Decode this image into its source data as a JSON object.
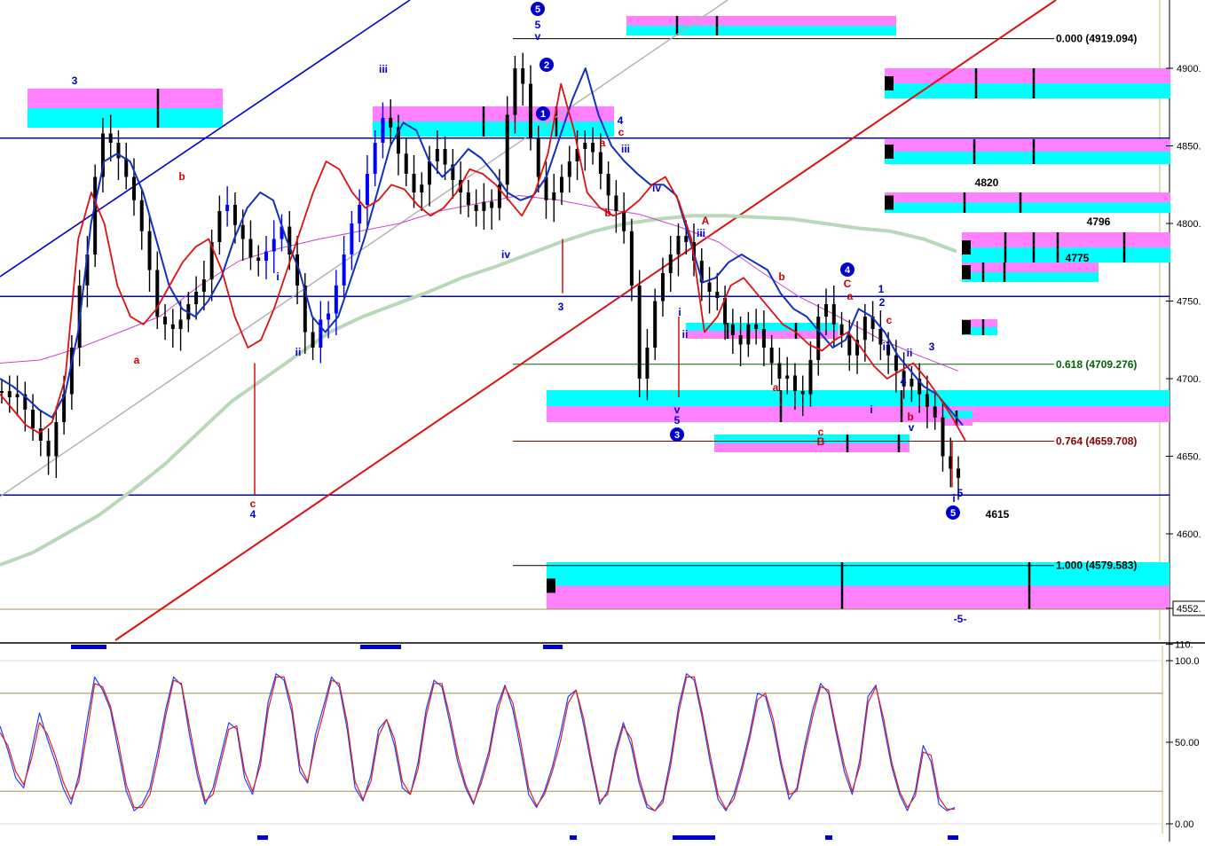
{
  "colors": {
    "background": "#ffffff",
    "hline": "#0000cc",
    "trend_blue": "#0000cc",
    "trend_red": "#dd1111",
    "trend_gray": "#b0b0b0",
    "ma_green": "#b8d8b8",
    "ma_pink": "#cc44cc",
    "env_blue": "#1030c0",
    "env_red": "#dd1111",
    "cyan": "#00ffff",
    "magenta": "#ff80ff",
    "stoch_blue": "#2040ff",
    "stoch_red": "#e02020",
    "grid_olive": "#a09050",
    "price_bars": "#000000",
    "up_bars": "#0000ff"
  },
  "chart_data": [
    {
      "type": "line",
      "panel": "price",
      "title": "",
      "ylim": [
        4552,
        4935
      ],
      "y_ticks": [
        "4900.",
        "4850.",
        "4800.",
        "4750.",
        "4700.",
        "4650.",
        "4600.",
        "4552."
      ],
      "y_tick_values": [
        4900,
        4850,
        4800,
        4750,
        4700,
        4650,
        4600,
        4552
      ],
      "horizontal_levels": [
        4855,
        4753,
        4625
      ],
      "fib_levels": [
        {
          "label": "0.000 (4919.094)",
          "value": 4919.094,
          "color": "#000000"
        },
        {
          "label": "0.618 (4709.276)",
          "value": 4709.276,
          "color": "#006600"
        },
        {
          "label": "0.764 (4659.708)",
          "value": 4659.708,
          "color": "#880000"
        },
        {
          "label": "1.000 (4579.583)",
          "value": 4579.583,
          "color": "#000000"
        }
      ],
      "level_labels": [
        "4820",
        "4796",
        "4775",
        "4615"
      ],
      "series": [
        {
          "role": "price_hl",
          "values": [
            4692,
            4688,
            4690,
            4680,
            4668,
            4660,
            4650,
            4672,
            4690,
            4720,
            4760,
            4780,
            4830,
            4858,
            4852,
            4842,
            4830,
            4815,
            4795,
            4770,
            4740,
            4735,
            4732,
            4738,
            4748,
            4756,
            4764,
            4788,
            4808,
            4812,
            4799,
            4790,
            4778,
            4776,
            4782,
            4790,
            4798,
            4780,
            4760,
            4730,
            4720,
            4738,
            4742,
            4760,
            4780,
            4800,
            4812,
            4832,
            4852,
            4868,
            4862,
            4845,
            4832,
            4820,
            4825,
            4840,
            4848,
            4838,
            4828,
            4820,
            4812,
            4808,
            4814,
            4810,
            4825,
            4870,
            4900,
            4890,
            4855,
            4830,
            4815,
            4820,
            4830,
            4840,
            4848,
            4852,
            4846,
            4832,
            4818,
            4808,
            4795,
            4760,
            4700,
            4720,
            4750,
            4768,
            4780,
            4792,
            4788,
            4776,
            4762,
            4756,
            4752,
            4735,
            4728,
            4722,
            4735,
            4732,
            4720,
            4710,
            4700,
            4702,
            4692,
            4690,
            4712,
            4740,
            4748,
            4735,
            4728,
            4715,
            4725,
            4740,
            4732,
            4722,
            4715,
            4705,
            4695,
            4700,
            4690,
            4682,
            4675,
            4650,
            4642,
            4636
          ]
        },
        {
          "role": "blue_band",
          "values": [
            4700,
            4695,
            4688,
            4680,
            4675,
            4690,
            4730,
            4800,
            4840,
            4845,
            4840,
            4820,
            4790,
            4760,
            4745,
            4740,
            4750,
            4765,
            4790,
            4810,
            4820,
            4815,
            4790,
            4770,
            4740,
            4730,
            4740,
            4765,
            4790,
            4820,
            4850,
            4865,
            4860,
            4840,
            4830,
            4838,
            4848,
            4842,
            4832,
            4820,
            4815,
            4818,
            4830,
            4855,
            4880,
            4900,
            4870,
            4850,
            4840,
            4832,
            4825,
            4825,
            4818,
            4790,
            4762,
            4765,
            4775,
            4780,
            4775,
            4770,
            4755,
            4745,
            4740,
            4730,
            4720,
            4725,
            4745,
            4740,
            4730,
            4715,
            4705,
            4695,
            4690,
            4680,
            4670
          ]
        },
        {
          "role": "red_band",
          "values": [
            4690,
            4680,
            4670,
            4665,
            4672,
            4700,
            4790,
            4820,
            4800,
            4760,
            4740,
            4735,
            4745,
            4760,
            4775,
            4785,
            4790,
            4770,
            4740,
            4720,
            4725,
            4745,
            4770,
            4795,
            4820,
            4840,
            4835,
            4820,
            4810,
            4815,
            4825,
            4822,
            4812,
            4805,
            4810,
            4820,
            4835,
            4832,
            4825,
            4815,
            4805,
            4820,
            4845,
            4890,
            4860,
            4820,
            4810,
            4805,
            4808,
            4815,
            4825,
            4830,
            4815,
            4790,
            4730,
            4740,
            4760,
            4765,
            4755,
            4745,
            4735,
            4730,
            4722,
            4718,
            4725,
            4730,
            4720,
            4708,
            4700,
            4705,
            4710,
            4700,
            4688,
            4675,
            4660
          ]
        },
        {
          "role": "sma_green",
          "values": [
            4580,
            4588,
            4600,
            4612,
            4628,
            4645,
            4665,
            4685,
            4700,
            4715,
            4730,
            4740,
            4748,
            4756,
            4765,
            4772,
            4780,
            4788,
            4795,
            4800,
            4803,
            4805,
            4805,
            4804,
            4803,
            4800,
            4797,
            4795,
            4790,
            4782
          ]
        },
        {
          "role": "ma_pink",
          "values": [
            4710,
            4712,
            4720,
            4730,
            4740,
            4760,
            4776,
            4784,
            4790,
            4795,
            4800,
            4808,
            4813,
            4818,
            4815,
            4810,
            4806,
            4798,
            4788,
            4770,
            4753,
            4740,
            4726,
            4715,
            4705
          ]
        }
      ]
    },
    {
      "type": "line",
      "panel": "stochastic",
      "ylim": [
        -2,
        110
      ],
      "y_ticks": [
        "110.",
        "100.0",
        "50.00",
        "0.00"
      ],
      "y_tick_values": [
        110,
        100,
        50,
        0
      ],
      "levels": [
        80,
        20
      ],
      "series": [
        {
          "role": "%K",
          "values": [
            60,
            45,
            28,
            22,
            45,
            68,
            52,
            38,
            22,
            12,
            30,
            62,
            90,
            82,
            70,
            45,
            20,
            8,
            12,
            22,
            45,
            70,
            90,
            85,
            55,
            30,
            12,
            22,
            42,
            62,
            58,
            28,
            18,
            40,
            75,
            92,
            88,
            68,
            32,
            25,
            55,
            72,
            90,
            84,
            58,
            22,
            14,
            30,
            58,
            64,
            48,
            22,
            18,
            38,
            70,
            88,
            84,
            62,
            38,
            22,
            12,
            28,
            45,
            72,
            85,
            70,
            45,
            18,
            10,
            20,
            35,
            55,
            78,
            82,
            60,
            35,
            12,
            20,
            45,
            62,
            48,
            25,
            10,
            8,
            15,
            40,
            72,
            92,
            88,
            65,
            38,
            15,
            8,
            18,
            35,
            55,
            80,
            78,
            60,
            35,
            15,
            22,
            48,
            70,
            86,
            80,
            55,
            32,
            18,
            40,
            78,
            85,
            60,
            35,
            18,
            8,
            20,
            48,
            38,
            12,
            8,
            10
          ]
        },
        {
          "role": "%D",
          "values": [
            56,
            48,
            32,
            24,
            40,
            62,
            55,
            42,
            26,
            15,
            26,
            55,
            86,
            84,
            72,
            50,
            24,
            10,
            10,
            18,
            40,
            66,
            88,
            86,
            60,
            34,
            14,
            18,
            38,
            58,
            60,
            32,
            20,
            36,
            70,
            90,
            90,
            72,
            36,
            26,
            50,
            68,
            88,
            86,
            62,
            26,
            15,
            26,
            54,
            64,
            52,
            26,
            18,
            34,
            66,
            86,
            86,
            66,
            42,
            24,
            13,
            25,
            42,
            68,
            84,
            74,
            50,
            22,
            11,
            18,
            32,
            50,
            74,
            82,
            64,
            38,
            14,
            18,
            42,
            60,
            52,
            28,
            12,
            8,
            13,
            36,
            68,
            90,
            90,
            68,
            42,
            18,
            9,
            15,
            32,
            52,
            76,
            80,
            64,
            38,
            18,
            20,
            44,
            66,
            84,
            82,
            58,
            36,
            20,
            36,
            74,
            84,
            64,
            38,
            20,
            10,
            17,
            44,
            42,
            16,
            9,
            9
          ]
        }
      ]
    }
  ],
  "wave_labels": [
    {
      "text": "3",
      "color": "#0000cc"
    },
    {
      "text": "a",
      "color": "#cc0000"
    },
    {
      "text": "b",
      "color": "#cc0000"
    },
    {
      "text": "c",
      "color": "#cc0000"
    },
    {
      "text": "4",
      "color": "#0000cc"
    },
    {
      "text": "i",
      "color": "#0000cc"
    },
    {
      "text": "ii",
      "color": "#0000cc"
    },
    {
      "text": "iii",
      "color": "#0000cc"
    },
    {
      "text": "iv",
      "color": "#0000cc"
    },
    {
      "text": "v",
      "color": "#0000cc"
    },
    {
      "text": "5",
      "color": "#0000cc"
    },
    {
      "text": "3",
      "color": "#0000cc"
    },
    {
      "text": "4",
      "color": "#0000cc"
    },
    {
      "text": "c",
      "color": "#cc0000"
    },
    {
      "text": "a",
      "color": "#cc0000"
    },
    {
      "text": "b",
      "color": "#cc0000"
    },
    {
      "text": "iii",
      "color": "#0000cc"
    },
    {
      "text": "iv",
      "color": "#0000cc"
    },
    {
      "text": "A",
      "color": "#cc0000"
    },
    {
      "text": "iii",
      "color": "#0000cc"
    },
    {
      "text": "i",
      "color": "#0000cc"
    },
    {
      "text": "ii",
      "color": "#0000cc"
    },
    {
      "text": "v",
      "color": "#0000cc"
    },
    {
      "text": "5",
      "color": "#0000cc"
    },
    {
      "text": "b",
      "color": "#cc0000"
    },
    {
      "text": "a",
      "color": "#cc0000"
    },
    {
      "text": "c",
      "color": "#cc0000"
    },
    {
      "text": "B",
      "color": "#cc0000"
    },
    {
      "text": "C",
      "color": "#cc0000"
    },
    {
      "text": "a",
      "color": "#cc0000"
    },
    {
      "text": "1",
      "color": "#0000cc"
    },
    {
      "text": "2",
      "color": "#0000cc"
    },
    {
      "text": "c",
      "color": "#cc0000"
    },
    {
      "text": "ii",
      "color": "#0000cc"
    },
    {
      "text": "i",
      "color": "#0000cc"
    },
    {
      "text": "b",
      "color": "#cc0000"
    },
    {
      "text": "v",
      "color": "#0000cc"
    },
    {
      "text": "3",
      "color": "#0000cc"
    },
    {
      "text": "4",
      "color": "#0000cc"
    },
    {
      "text": "ii",
      "color": "#0000cc"
    },
    {
      "text": "i",
      "color": "#0000cc"
    },
    {
      "text": "5",
      "color": "#0000cc"
    },
    {
      "text": "-5-",
      "color": "#0000cc"
    },
    {
      "text": "-5-",
      "color": "#0000cc"
    }
  ],
  "circled_labels": [
    "5",
    "2",
    "1",
    "3",
    "4",
    "5"
  ]
}
